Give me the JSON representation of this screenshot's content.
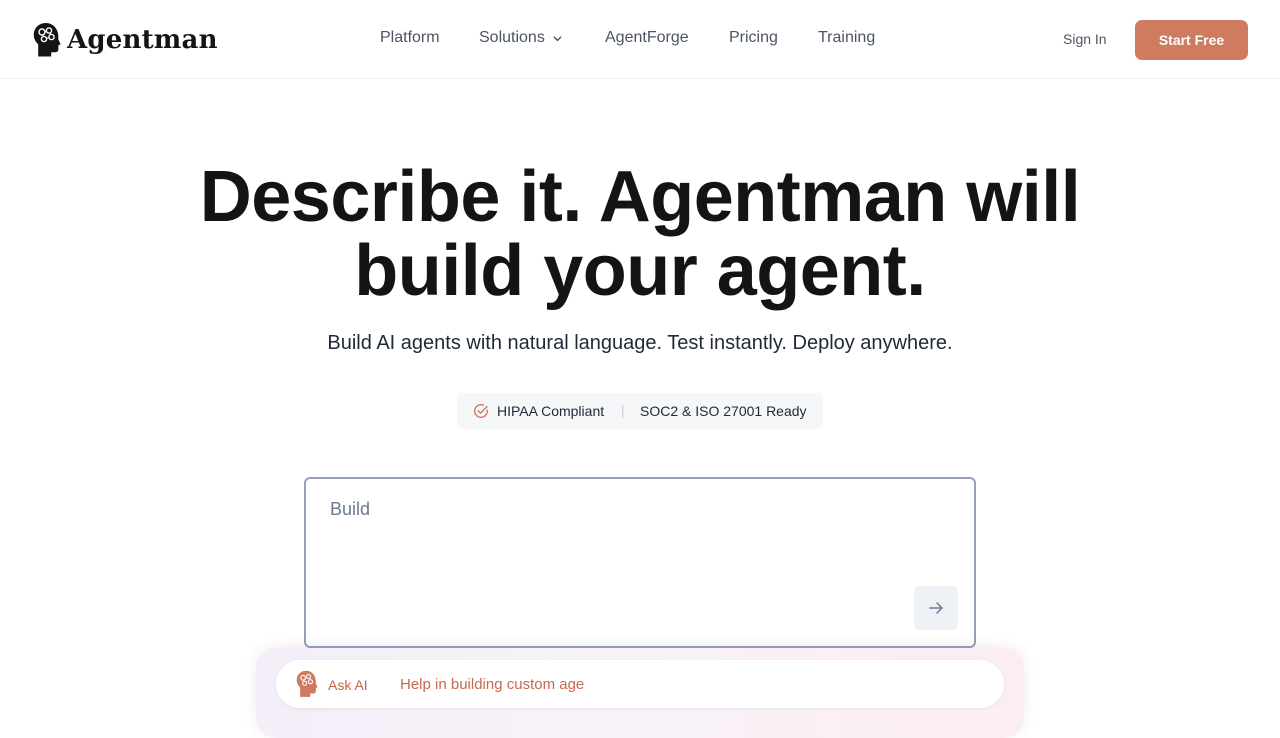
{
  "brand": {
    "name": "Agentman",
    "logo_icon": "brain-head-icon",
    "accent_color": "#cf7b5f"
  },
  "nav": {
    "items": [
      {
        "label": "Platform"
      },
      {
        "label": "Solutions",
        "icon": "chevron-down-icon"
      },
      {
        "label": "AgentForge"
      },
      {
        "label": "Pricing"
      },
      {
        "label": "Training"
      }
    ],
    "sign_in": "Sign In",
    "start_free": "Start Free"
  },
  "hero": {
    "title_line1": "Describe it. Agentman will",
    "title_line2": "build your agent.",
    "subtitle": "Build AI agents with natural language. Test instantly. Deploy anywhere."
  },
  "compliance": {
    "icon": "check-circle-icon",
    "hipaa": "HIPAA Compliant",
    "separator": "|",
    "soc": "SOC2 & ISO 27001 Ready"
  },
  "builder": {
    "placeholder": "Build",
    "submit_icon": "arrow-right-icon"
  },
  "ask_ai": {
    "label": "Ask AI",
    "placeholder": "Help in building custom age",
    "icon": "brain-head-icon"
  }
}
